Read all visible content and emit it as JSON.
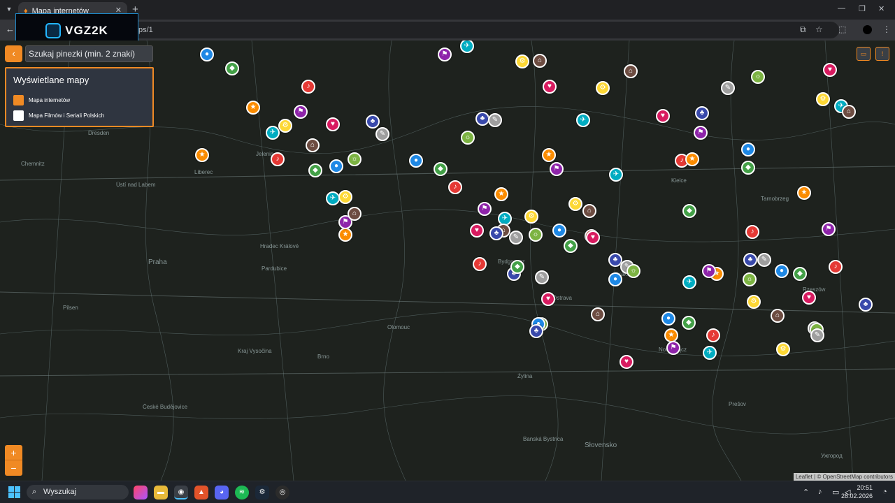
{
  "browser": {
    "tab_title": "Mapa internetów",
    "address_suffix": "ps/1",
    "new_tab_glyph": "+",
    "close_glyph": "✕"
  },
  "overlay_logo": {
    "text": "VGZ2K"
  },
  "map_ui": {
    "search_placeholder": "Szukaj pinezki (min. 2 znaki)",
    "back_glyph": "‹",
    "legend_title": "Wyświetlane mapy",
    "legend_items": [
      {
        "label": "Mapa internetów",
        "color": "#f08a24"
      },
      {
        "label": "Mapa Filmów i Seriali Polskich",
        "color": "#ffffff"
      }
    ],
    "zoom_in": "+",
    "zoom_out": "−",
    "attribution": "Leaflet | © OpenStreetMap contributors"
  },
  "cities": [
    "Dresden",
    "Chemnitz",
    "Praha",
    "Pardubice",
    "Hradec Králové",
    "Olomouc",
    "Brno",
    "Pilsen",
    "Bydgoszcz",
    "Ostrava",
    "Żylina",
    "Nowy Sącz",
    "Tarnobrzeg",
    "Rzeszów",
    "Kraków",
    "Kielce",
    "Słovensko",
    "Banská Bystrica",
    "Prešov",
    "Ústí nad Labem",
    "Liberec",
    "Jelenia",
    "České Budějovice",
    "Kraj Vysočina",
    "Ужгород"
  ],
  "pins": [
    {
      "color": "#1e88e5",
      "glyph": "●"
    },
    {
      "color": "#43a047",
      "glyph": "◆"
    },
    {
      "color": "#e53935",
      "glyph": "♪"
    },
    {
      "color": "#fb8c00",
      "glyph": "★"
    },
    {
      "color": "#8e24aa",
      "glyph": "⚑"
    },
    {
      "color": "#00acc1",
      "glyph": "✈"
    },
    {
      "color": "#fdd835",
      "glyph": "⚙"
    },
    {
      "color": "#6d4c41",
      "glyph": "⌂"
    },
    {
      "color": "#d81b60",
      "glyph": "♥"
    },
    {
      "color": "#3949ab",
      "glyph": "♣"
    },
    {
      "color": "#9e9e9e",
      "glyph": "✎"
    },
    {
      "color": "#7cb342",
      "glyph": "☼"
    }
  ],
  "taskbar": {
    "search_label": "Wyszukaj",
    "time": "20:51",
    "date": "28.02.2026"
  }
}
